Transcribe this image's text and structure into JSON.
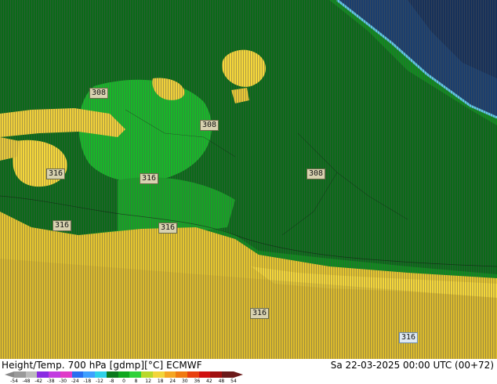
{
  "map": {
    "colors": {
      "green_dark": "#0b6e1a",
      "green_mid": "#12a81f",
      "green_light": "#1fd133",
      "yellow": "#f5d73a",
      "yellow_dark": "#c9a62a",
      "cyan": "#5fc8e8",
      "blue_dark": "#1a3e6e",
      "hatch": "#000000"
    },
    "contour_labels": [
      "308",
      "308",
      "308",
      "316",
      "316",
      "316",
      "316",
      "316",
      "316"
    ]
  },
  "footer": {
    "title": "Height/Temp. 700 hPa [gdmp][°C] ECMWF",
    "timestamp": "Sa 22-03-2025 00:00 UTC (00+72)"
  },
  "colorbar": {
    "ticks": [
      "-54",
      "-48",
      "-42",
      "-38",
      "-30",
      "-24",
      "-18",
      "-12",
      "-8",
      "0",
      "8",
      "12",
      "18",
      "24",
      "30",
      "36",
      "42",
      "48",
      "54"
    ],
    "colors": [
      "#9a9a9a",
      "#bcbcbc",
      "#8a2be2",
      "#c23be0",
      "#e03cc8",
      "#2a6ff0",
      "#3fa0ff",
      "#2fd1e8",
      "#0a7a1e",
      "#10a820",
      "#2fd13a",
      "#b8d82a",
      "#f2d53a",
      "#f5a623",
      "#f07a12",
      "#e84010",
      "#d01010",
      "#a01010",
      "#6b1a1a"
    ]
  }
}
